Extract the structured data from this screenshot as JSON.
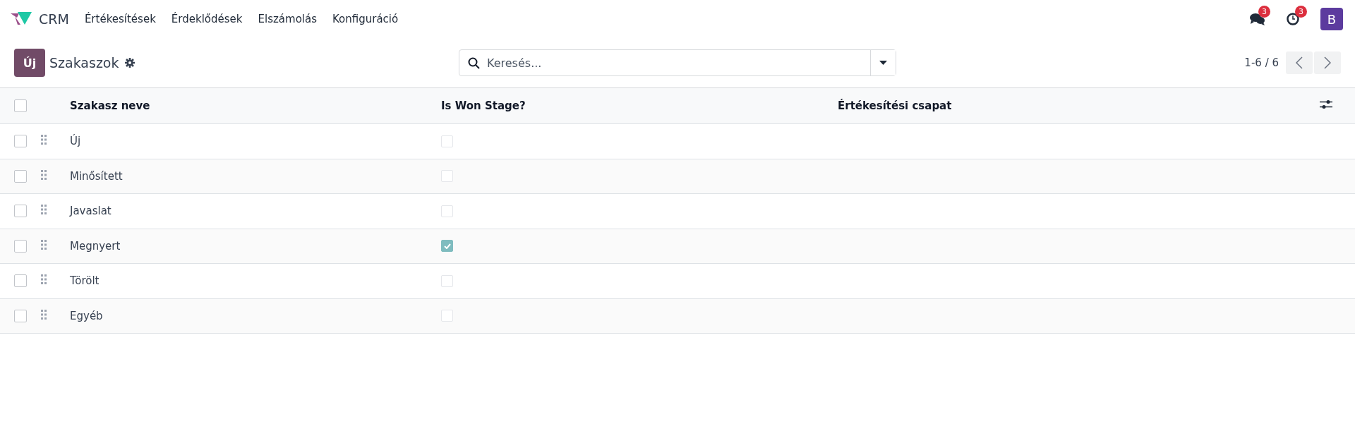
{
  "navbar": {
    "app_name": "CRM",
    "menu": [
      "Értékesítések",
      "Érdeklődések",
      "Elszámolás",
      "Konfiguráció"
    ],
    "messages_count": "3",
    "activities_count": "3",
    "avatar_letter": "B"
  },
  "control_panel": {
    "new_button": "Új",
    "title": "Szakaszok",
    "search": {
      "placeholder": "Keresés..."
    },
    "pager": "1-6 / 6"
  },
  "table": {
    "select_all": {
      "checked": false
    },
    "columns": [
      "Szakasz neve",
      "Is Won Stage?",
      "Értékesítési csapat"
    ],
    "rows": [
      {
        "name": "Új",
        "selected": false,
        "is_won": false
      },
      {
        "name": "Minősített",
        "selected": false,
        "is_won": false
      },
      {
        "name": "Javaslat",
        "selected": false,
        "is_won": false
      },
      {
        "name": "Megnyert",
        "selected": false,
        "is_won": true
      },
      {
        "name": "Törölt",
        "selected": false,
        "is_won": false
      },
      {
        "name": "Egyéb",
        "selected": false,
        "is_won": false
      }
    ]
  }
}
